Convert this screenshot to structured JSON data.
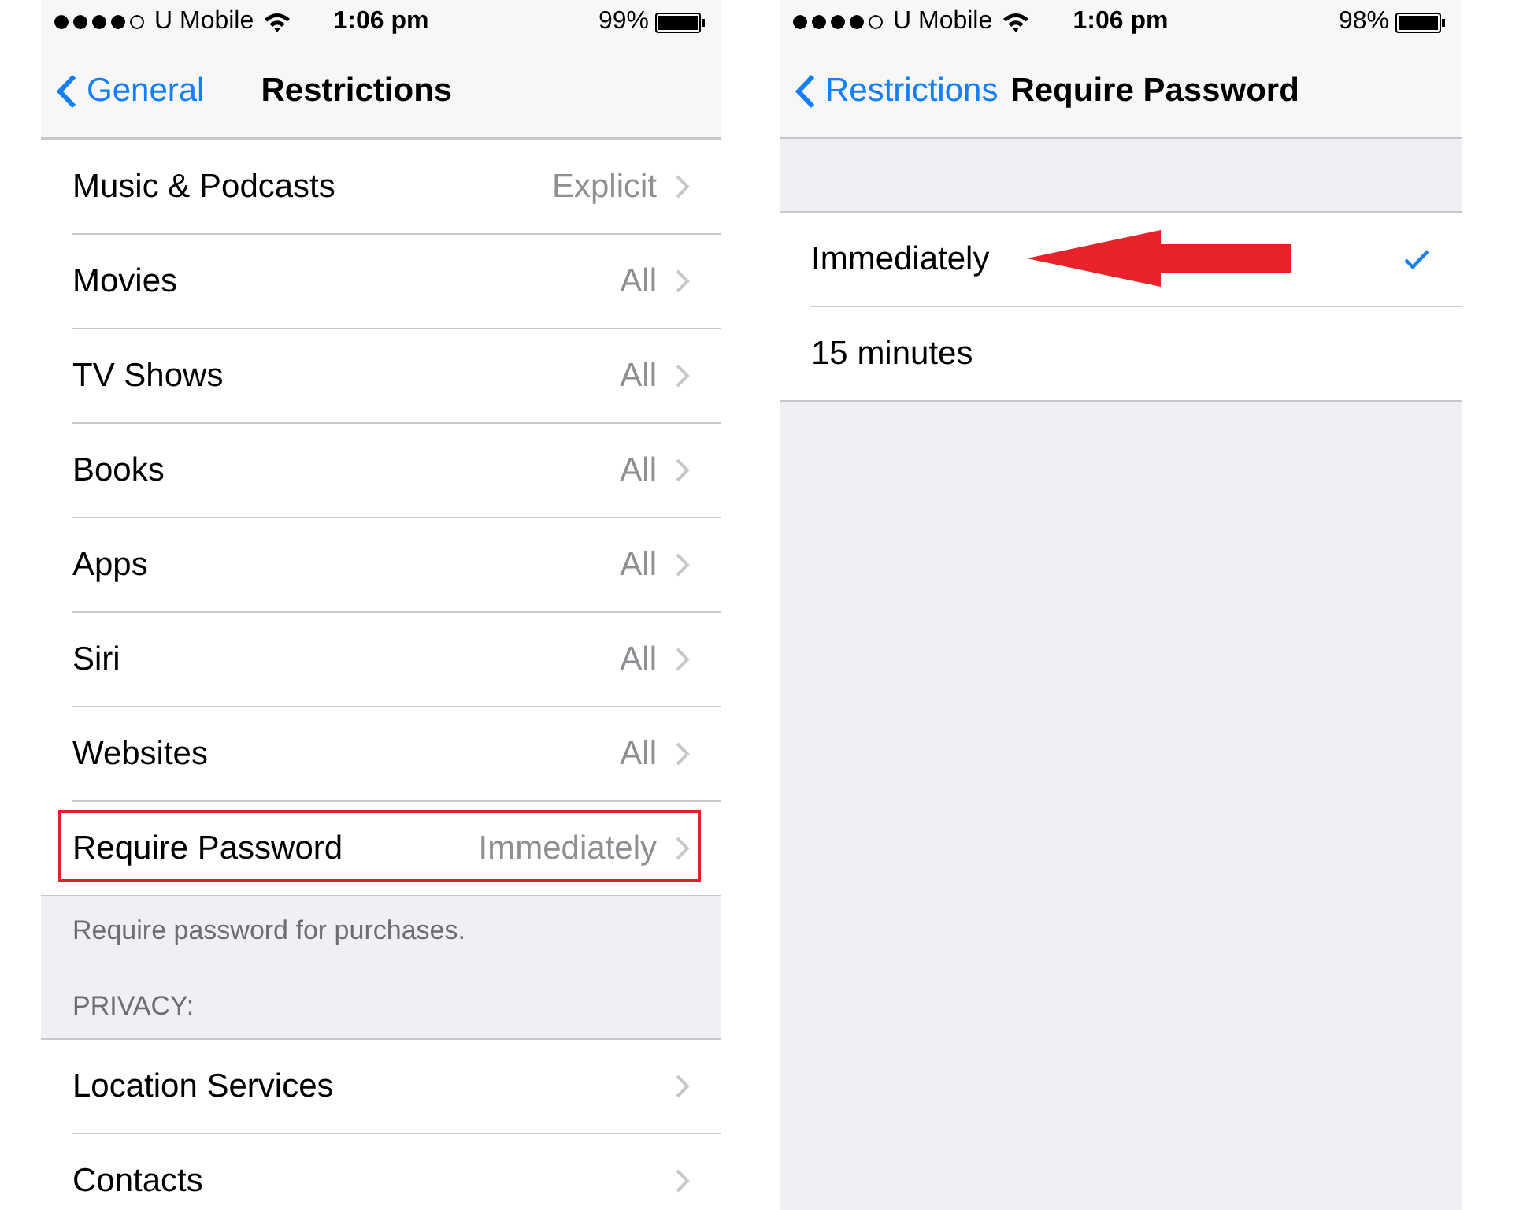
{
  "screens": [
    {
      "status_bar": {
        "carrier": "U Mobile",
        "time": "1:06 pm",
        "battery": "99%"
      },
      "nav": {
        "back": "General",
        "title": "Restrictions"
      },
      "sections": [
        {
          "rows": [
            {
              "kind": "disclosure",
              "label": "Music & Podcasts",
              "value": "Explicit",
              "highlighted": false
            },
            {
              "kind": "disclosure",
              "label": "Movies",
              "value": "All",
              "highlighted": false
            },
            {
              "kind": "disclosure",
              "label": "TV Shows",
              "value": "All",
              "highlighted": false
            },
            {
              "kind": "disclosure",
              "label": "Books",
              "value": "All",
              "highlighted": false
            },
            {
              "kind": "disclosure",
              "label": "Apps",
              "value": "All",
              "highlighted": false
            },
            {
              "kind": "disclosure",
              "label": "Siri",
              "value": "All",
              "highlighted": false
            },
            {
              "kind": "disclosure",
              "label": "Websites",
              "value": "All",
              "highlighted": false
            },
            {
              "kind": "disclosure",
              "label": "Require Password",
              "value": "Immediately",
              "highlighted": true
            }
          ],
          "footer": "Require password for purchases."
        },
        {
          "header": "PRIVACY:",
          "rows": [
            {
              "kind": "disclosure",
              "label": "Location Services",
              "highlighted": false
            },
            {
              "kind": "disclosure",
              "label": "Contacts",
              "highlighted": false
            }
          ]
        }
      ]
    },
    {
      "status_bar": {
        "carrier": "U Mobile",
        "time": "1:06 pm",
        "battery": "98%"
      },
      "nav": {
        "back": "Restrictions",
        "title": "Require Password"
      },
      "sections": [
        {
          "rows": [
            {
              "kind": "choice",
              "label": "Immediately",
              "selected": true,
              "annotated": true
            },
            {
              "kind": "choice",
              "label": "15 minutes",
              "selected": false,
              "annotated": false
            }
          ]
        }
      ]
    }
  ]
}
